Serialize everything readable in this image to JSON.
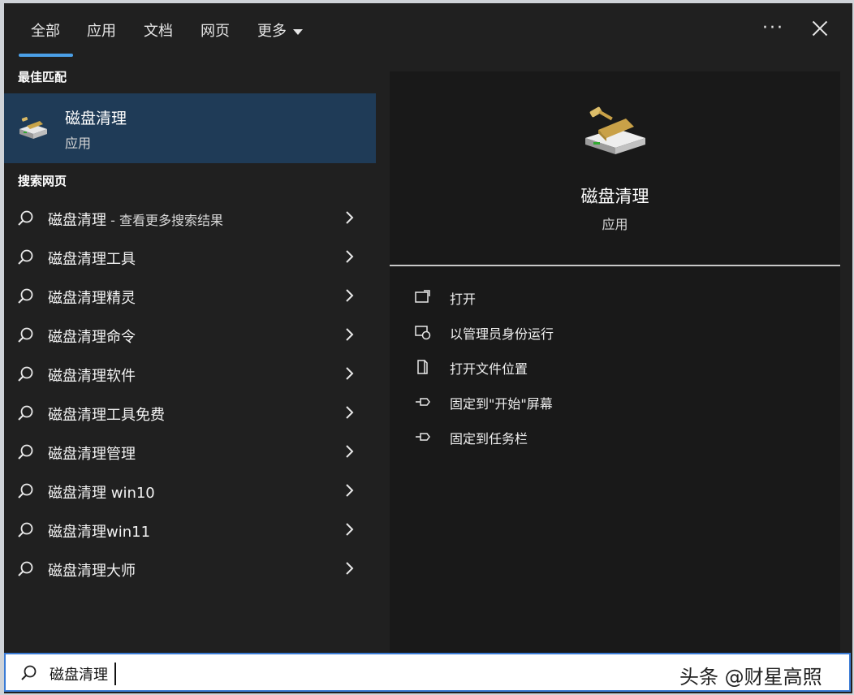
{
  "tabs": [
    {
      "label": "全部",
      "active": true
    },
    {
      "label": "应用"
    },
    {
      "label": "文档"
    },
    {
      "label": "网页"
    },
    {
      "label": "更多"
    }
  ],
  "window_controls": {
    "more": "···"
  },
  "best_match": {
    "heading": "最佳匹配",
    "title": "磁盘清理",
    "subtitle": "应用",
    "icon": "disk-cleanup-icon"
  },
  "web_search": {
    "heading": "搜索网页",
    "items": [
      {
        "label": "磁盘清理",
        "suffix": " - 查看更多搜索结果"
      },
      {
        "label": "磁盘清理工具",
        "suffix": ""
      },
      {
        "label": "磁盘清理精灵",
        "suffix": ""
      },
      {
        "label": "磁盘清理命令",
        "suffix": ""
      },
      {
        "label": "磁盘清理软件",
        "suffix": ""
      },
      {
        "label": "磁盘清理工具免费",
        "suffix": ""
      },
      {
        "label": "磁盘清理管理",
        "suffix": ""
      },
      {
        "label": "磁盘清理 win10",
        "suffix": ""
      },
      {
        "label": "磁盘清理win11",
        "suffix": ""
      },
      {
        "label": "磁盘清理大师",
        "suffix": ""
      }
    ]
  },
  "detail": {
    "title": "磁盘清理",
    "subtitle": "应用",
    "actions": [
      {
        "label": "打开",
        "icon": "open-icon"
      },
      {
        "label": "以管理员身份运行",
        "icon": "run-as-admin-icon"
      },
      {
        "label": "打开文件位置",
        "icon": "file-location-icon"
      },
      {
        "label": "固定到\"开始\"屏幕",
        "icon": "pin-start-icon"
      },
      {
        "label": "固定到任务栏",
        "icon": "pin-taskbar-icon"
      }
    ]
  },
  "search": {
    "value": "磁盘清理",
    "placeholder": ""
  },
  "watermark": "头条 @财星高照",
  "colors": {
    "accent": "#4ba0e8",
    "selected_bg": "#1f3b57",
    "panel_bg": "#191919",
    "window_bg": "#202020"
  }
}
